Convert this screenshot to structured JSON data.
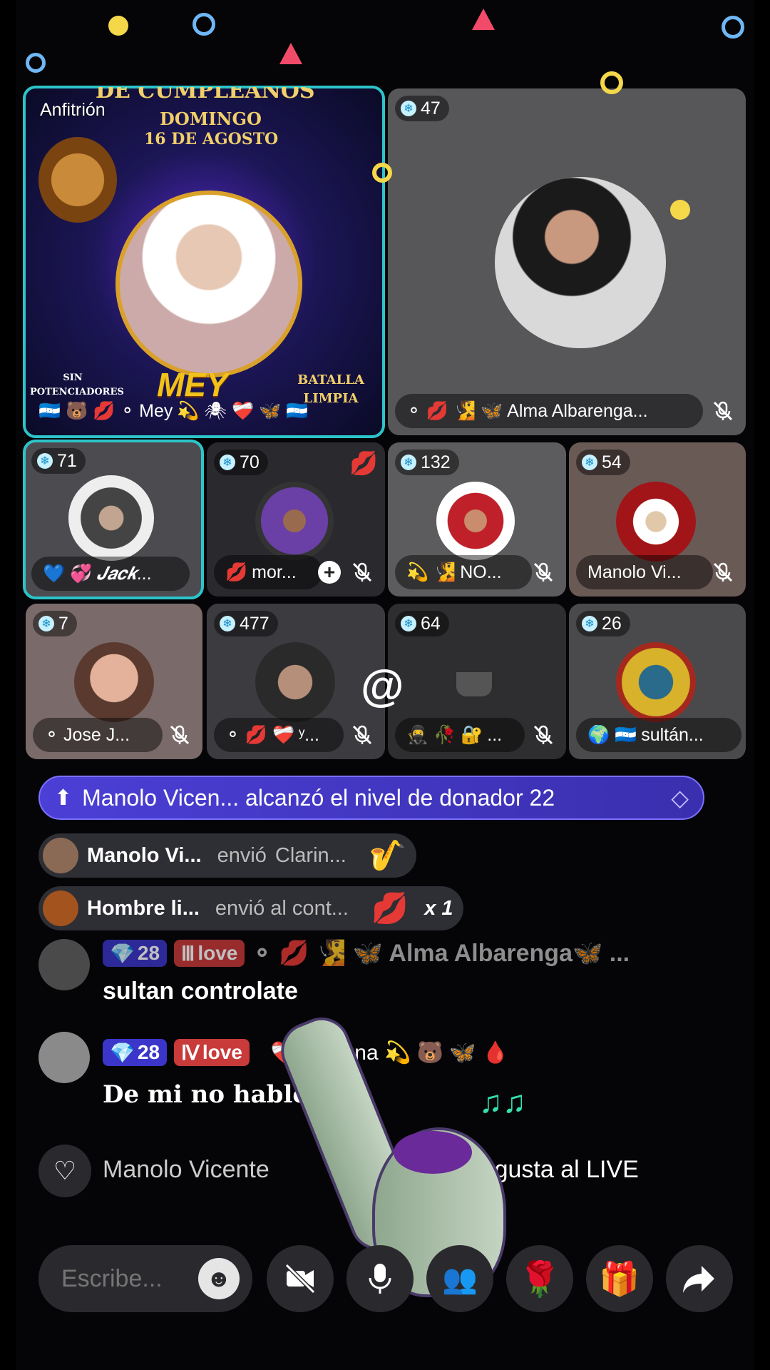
{
  "host_tile": {
    "role_label": "Anfitrión",
    "banner_top": "DE CUMPLEAÑOS",
    "banner_day": "DOMINGO",
    "banner_date": "16 DE AGOSTO",
    "banner_name": "MEY",
    "banner_left": "SIN POTENCIADORES",
    "banner_right": "BATALLA LIMPIA",
    "name": "Mey",
    "name_prefix": "🇭🇳 🐻 💋 ⚬",
    "name_suffix": "💫 🕷 ❤️‍🩹 🦋 🇭🇳"
  },
  "guests": [
    {
      "count": "47",
      "name": "Alma Albarenga...",
      "prefix": "⚬ 💋 🧏 🦋"
    },
    {
      "count": "71",
      "name": "𝑱𝒂𝒄𝒌...",
      "prefix": "💙 💞"
    },
    {
      "count": "70",
      "name": "mor...",
      "prefix": "💋"
    },
    {
      "count": "132",
      "name": "NO...",
      "prefix": "💫 🧏"
    },
    {
      "count": "54",
      "name": "Manolo Vi...",
      "prefix": ""
    },
    {
      "count": "7",
      "name": "Jose J...",
      "prefix": "⚬"
    },
    {
      "count": "477",
      "name": "ʸ...",
      "prefix": "⚬ 💋 ❤️‍🩹"
    },
    {
      "count": "64",
      "name": "...",
      "prefix": "🥷 🥀 🔐"
    },
    {
      "count": "26",
      "name": "sultán...",
      "prefix": "🌍 🇭🇳"
    }
  ],
  "overlay_symbol": "@",
  "level_banner": {
    "text": "Manolo Vicen... alcanzó el nivel de donador 22"
  },
  "gifts": [
    {
      "user": "Manolo Vi...",
      "action": "envió",
      "item": "Clarin...",
      "icon": "🎷",
      "count": ""
    },
    {
      "user": "Hombre li...",
      "action": "envió al cont...",
      "item": "",
      "icon": "💋",
      "count": "x 1"
    }
  ],
  "messages": [
    {
      "level": "28",
      "badge": "love",
      "name": "⚬ 💋 🧏 🦋 Alma Albarenga🦋 ...",
      "text": "sultan controlate"
    },
    {
      "level": "28",
      "badge": "love",
      "name": "❤️‍🩹 yOhana 💫 🐻 🦋 🩸",
      "text": "De  mi no hable"
    }
  ],
  "like_line": {
    "text_left": "Manolo Vicente",
    "text_mid": "ra",
    "text_right": "me gusta al LIVE"
  },
  "composer": {
    "placeholder": "Escribe..."
  },
  "colors": {
    "accent": "#2cc4c9",
    "level_banner": "#4b3fd6",
    "love_tag": "#c93a3a",
    "level_tag": "#3b36c9"
  }
}
